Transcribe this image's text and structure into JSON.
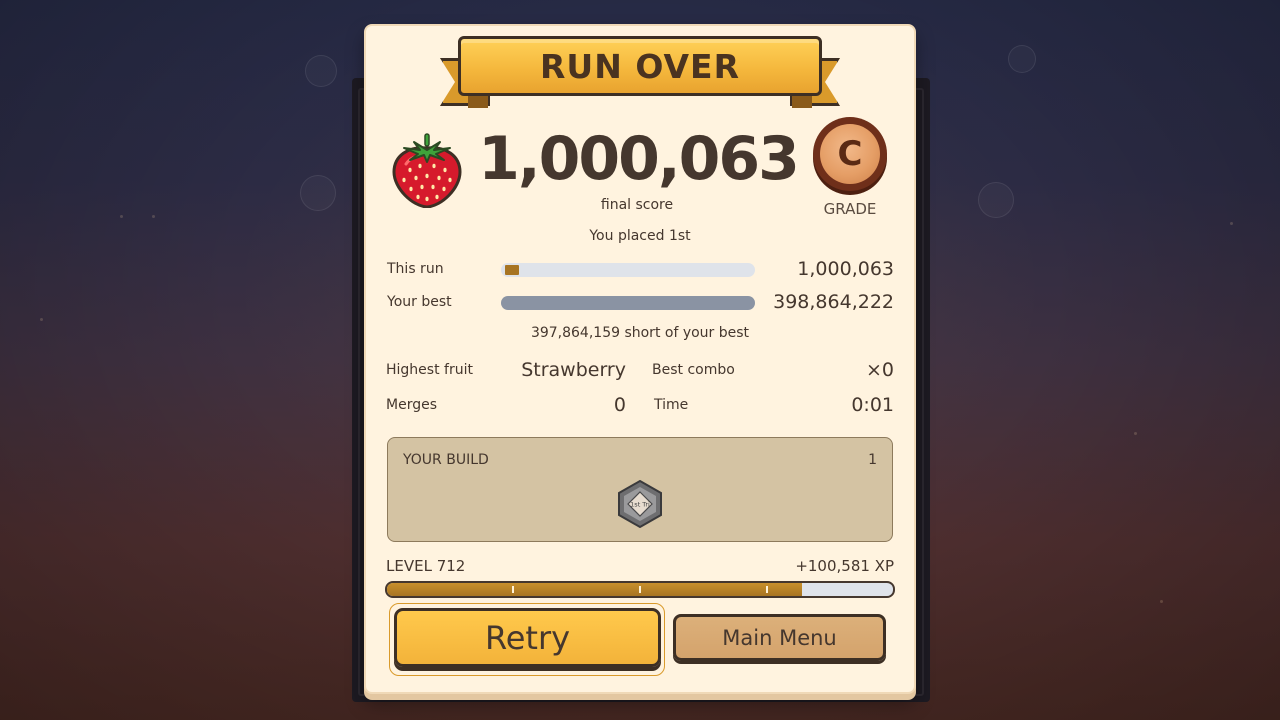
{
  "title": "RUN OVER",
  "score": {
    "value": "1,000,063",
    "label": "final score",
    "fruit_icon": "strawberry-icon"
  },
  "grade": {
    "letter": "C",
    "label": "GRADE"
  },
  "placed": "You placed 1st",
  "comparison": {
    "this_run": {
      "label": "This run",
      "value": "1,000,063",
      "fraction": 0.0025
    },
    "your_best": {
      "label": "Your best",
      "value": "398,864,222",
      "fraction": 1.0
    },
    "short_text": "397,864,159 short of your best"
  },
  "stats": {
    "highest_fruit": {
      "label": "Highest fruit",
      "value": "Strawberry"
    },
    "best_combo": {
      "label": "Best combo",
      "value": "×0"
    },
    "merges": {
      "label": "Merges",
      "value": "0"
    },
    "time": {
      "label": "Time",
      "value": "0:01"
    }
  },
  "build": {
    "title": "YOUR BUILD",
    "count": "1",
    "items": [
      {
        "label": "1st Tri",
        "icon": "hexagon-relic-icon"
      }
    ]
  },
  "level": {
    "label": "LEVEL 712",
    "xp_gain": "+100,581 XP",
    "progress": 0.82
  },
  "buttons": {
    "retry": "Retry",
    "main_menu": "Main Menu"
  },
  "colors": {
    "accent": "#f5b83d",
    "bar_fill": "#a77422",
    "card_bg": "#fff3df",
    "text": "#45372e"
  }
}
